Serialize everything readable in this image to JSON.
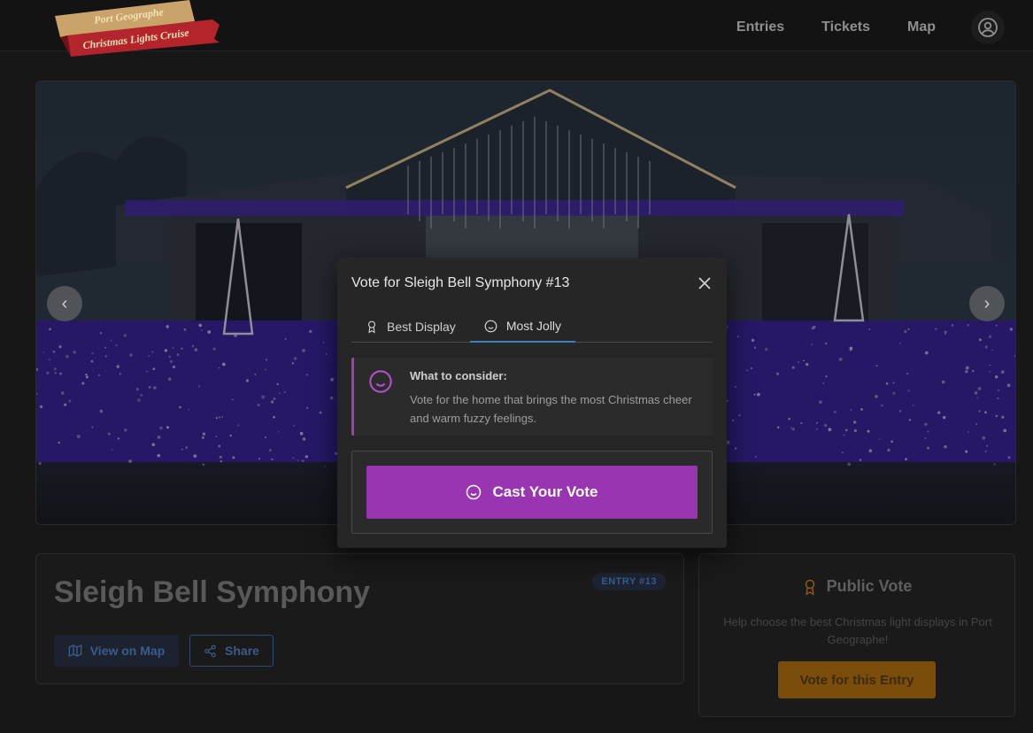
{
  "header": {
    "logo": {
      "line1": "Port Geographe",
      "line2": "Christmas Lights Cruise"
    },
    "nav": [
      "Entries",
      "Tickets",
      "Map"
    ],
    "account_icon": "user-circle-icon"
  },
  "hero": {
    "prev_icon": "‹",
    "next_icon": "›"
  },
  "entry": {
    "title": "Sleigh Bell Symphony",
    "badge": "ENTRY #13",
    "map_button": "View on Map",
    "share_button": "Share"
  },
  "public_vote": {
    "title": "Public Vote",
    "description": "Help choose the best Christmas light displays in Port Geographe!",
    "button": "Vote for this Entry"
  },
  "modal": {
    "title": "Vote for Sleigh Bell Symphony #13",
    "tabs": [
      {
        "label": "Best Display",
        "icon": "award-icon",
        "active": false
      },
      {
        "label": "Most Jolly",
        "icon": "smile-icon",
        "active": true
      }
    ],
    "consider_heading": "What to consider:",
    "consider_text": "Vote for the home that brings the most Christmas cheer and warm fuzzy feelings.",
    "cast_button": "Cast Your Vote"
  },
  "colors": {
    "accent_purple": "#9a35b2",
    "tab_active": "#3a82c4",
    "vote_orange": "#7a4e0a"
  }
}
